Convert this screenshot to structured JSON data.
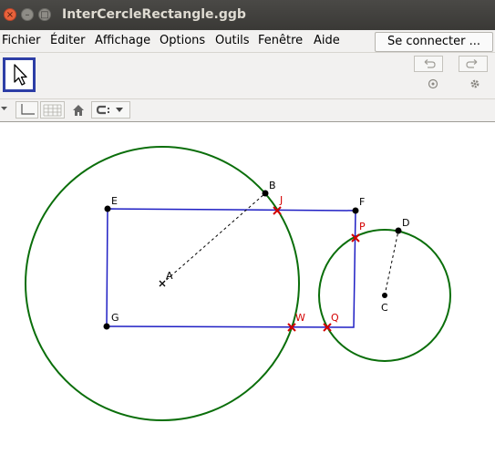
{
  "window": {
    "title": "InterCercleRectangle.ggb"
  },
  "menu": {
    "items": [
      "Fichier",
      "Éditer",
      "Affichage",
      "Options",
      "Outils",
      "Fenêtre",
      "Aide"
    ],
    "connect_label": "Se connecter ..."
  },
  "toolbar": {
    "active_tool": "move-tool"
  },
  "construction": {
    "points": {
      "A": "A",
      "B": "B",
      "C": "C",
      "D": "D",
      "E": "E",
      "F": "F",
      "G": "G"
    },
    "intersections": {
      "J": "J",
      "P": "P",
      "W": "W",
      "Q": "Q"
    },
    "colors": {
      "rectangle": "#1f1fc4",
      "circles": "#0a6e0a",
      "points": "#000000",
      "intersections": "#d40000"
    }
  }
}
